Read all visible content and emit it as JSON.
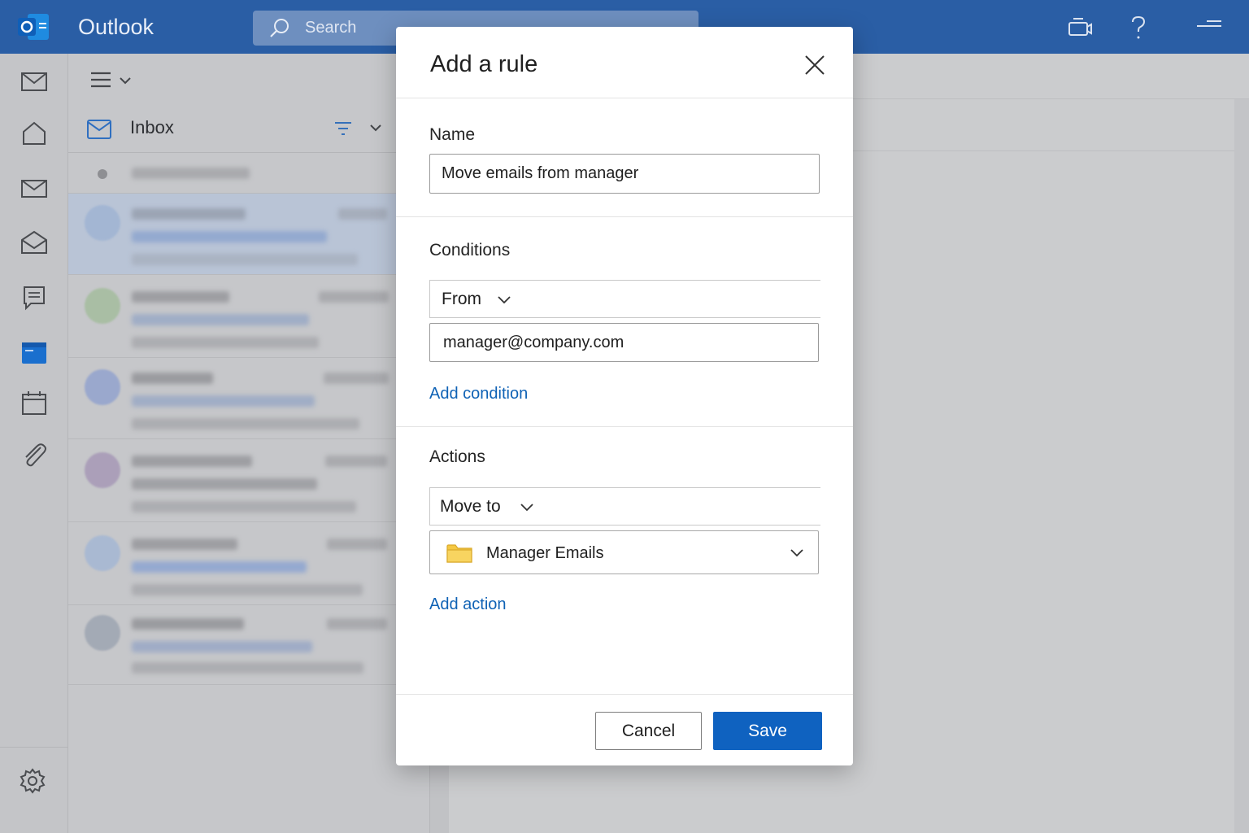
{
  "app": {
    "title": "Outlook"
  },
  "search": {
    "placeholder": "Search"
  },
  "list": {
    "folder_title": "Inbox"
  },
  "dialog": {
    "title": "Add a rule",
    "name_label": "Name",
    "name_value": "Move emails from manager",
    "conditions_label": "Conditions",
    "condition_type": "From",
    "condition_value": "manager@company.com",
    "add_condition": "Add condition",
    "actions_label": "Actions",
    "action_type": "Move to",
    "action_folder": "Manager Emails",
    "add_action": "Add action",
    "cancel_label": "Cancel",
    "save_label": "Save"
  },
  "colors": {
    "accent": "#0f62c0",
    "topbar": "#2a5ea5",
    "link": "#0f62b5",
    "folder": "#f5c842"
  }
}
